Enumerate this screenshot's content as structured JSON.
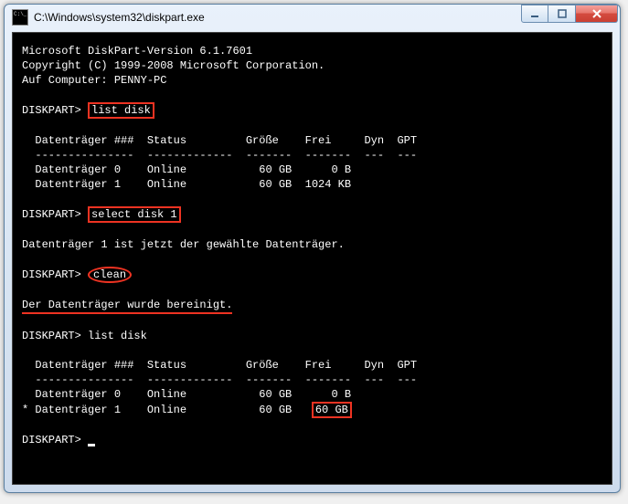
{
  "window": {
    "title": "C:\\Windows\\system32\\diskpart.exe"
  },
  "term": {
    "header1": "Microsoft DiskPart-Version 6.1.7601",
    "header2": "Copyright (C) 1999-2008 Microsoft Corporation.",
    "header3": "Auf Computer: PENNY-PC",
    "prompt": "DISKPART>",
    "cmd_list_disk": "list disk",
    "tbl_hdr": "  Datenträger ###  Status         Größe    Frei     Dyn  GPT",
    "tbl_div": "  ---------------  -------------  -------  -------  ---  ---",
    "tbl_r0": "  Datenträger 0    Online           60 GB      0 B",
    "tbl_r1": "  Datenträger 1    Online           60 GB  1024 KB",
    "cmd_select": "select disk 1",
    "msg_selected": "Datenträger 1 ist jetzt der gewählte Datenträger.",
    "cmd_clean": "clean",
    "msg_cleaned": "Der Datenträger wurde bereinigt.",
    "cmd_list_disk2": "list disk",
    "tbl2_r0": "  Datenträger 0    Online           60 GB      0 B",
    "tbl2_r1_pre": "* Datenträger 1    Online           60 GB   ",
    "tbl2_r1_hl": "60 GB"
  }
}
